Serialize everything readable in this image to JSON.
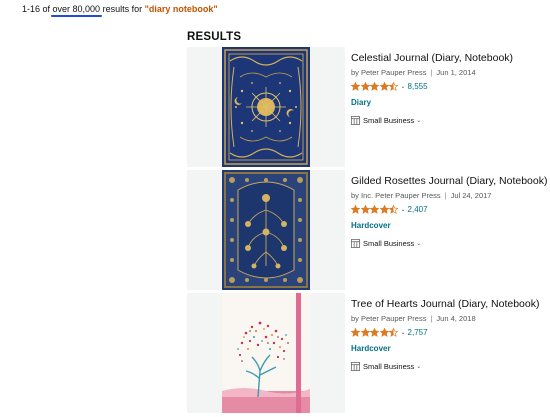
{
  "header": {
    "range": "1-16 of ",
    "total": "over 80,000",
    "middle": " results for ",
    "query": "\"diary notebook\""
  },
  "results_heading": "RESULTS",
  "results": [
    {
      "title": "Celestial Journal (Diary, Notebook)",
      "byline": "by Peter Pauper Press",
      "date": "Jun 1, 2014",
      "rating_count": "8,555",
      "format": "Diary",
      "small_business": "Small Business",
      "stars": 4.5
    },
    {
      "title": "Gilded Rosettes Journal (Diary, Notebook)",
      "byline": "by Inc. Peter Pauper Press",
      "date": "Jul 24, 2017",
      "rating_count": "2,407",
      "format": "Hardcover",
      "small_business": "Small Business",
      "stars": 4.5
    },
    {
      "title": "Tree of Hearts Journal (Diary, Notebook)",
      "byline": "by Peter Pauper Press",
      "date": "Jun 4, 2018",
      "rating_count": "2,757",
      "format": "Hardcover",
      "small_business": "Small Business",
      "stars": 4.5
    }
  ],
  "colors": {
    "link": "#007185",
    "star": "#de7921",
    "query": "#c45500",
    "underline": "#1a4fd6"
  }
}
